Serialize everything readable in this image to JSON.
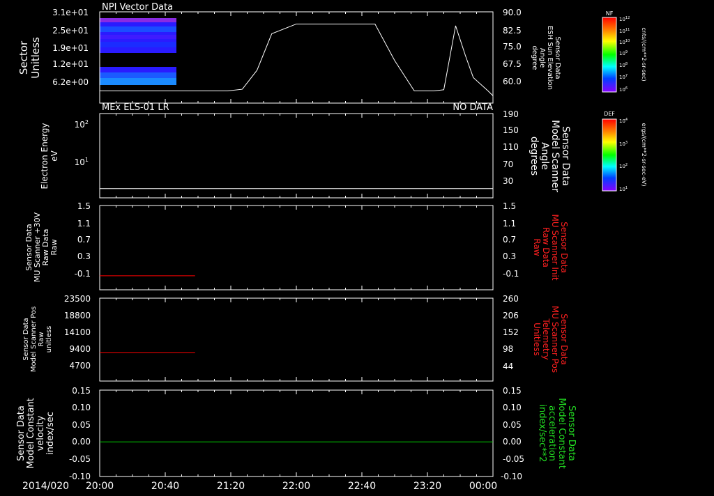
{
  "chart_data": [
    {
      "type": "heatmap+line",
      "title": "NPI Vector Data",
      "left_ylabel": [
        "Sector",
        "Unitless"
      ],
      "left_ticks": [
        "3.1e+01",
        "2.5e+01",
        "1.9e+01",
        "1.2e+01",
        "6.2e+00"
      ],
      "right_ylabel": [
        "Sensor Data",
        "ESH Sun Elevation",
        "Angle",
        "degree"
      ],
      "right_ticks": [
        "90.0",
        "82.5",
        "75.0",
        "67.5",
        "60.0"
      ],
      "right_ylim": [
        52.5,
        90.0
      ],
      "colorbar": {
        "label": "NF",
        "unit": "cnts/(cm**2-sr-sec)",
        "ticks": [
          "10^12",
          "10^11",
          "10^10",
          "10^9",
          "10^8",
          "10^7",
          "10^6"
        ]
      },
      "heatmap_x_range_hours": [
        0,
        0.833
      ],
      "line_series": {
        "color": "#ffffff",
        "x_hours": [
          0,
          0.5,
          1.0,
          1.3,
          1.45,
          1.6,
          1.75,
          2.0,
          2.5,
          2.8,
          3.0,
          3.2,
          3.3,
          3.4,
          3.5,
          3.62,
          3.72,
          3.8,
          3.95,
          4.0
        ],
        "y": [
          57.5,
          57.5,
          57.5,
          57.5,
          58.2,
          66,
          81,
          85,
          85,
          85,
          70,
          57.5,
          57.5,
          57.5,
          58,
          84.3,
          72,
          63,
          57.5,
          55.5
        ]
      }
    },
    {
      "type": "heatmap+line",
      "title": "MEx ELS-01 LR",
      "status": "NO DATA",
      "left_ylabel": [
        "Electron Energy",
        "eV"
      ],
      "left_ticks": [
        "10^2",
        "10^1"
      ],
      "right_ylabel": [
        "Sensor Data",
        "Model Scanner",
        "Angle",
        "degrees"
      ],
      "right_ticks": [
        "190",
        "150",
        "110",
        "70",
        "30"
      ],
      "right_ylim": [
        -10,
        190
      ],
      "colorbar": {
        "label": "DEF",
        "unit": "ergs/(cm**2-sr-sec-eV)",
        "ticks": [
          "10^4",
          "10^3",
          "10^2",
          "10^1"
        ]
      },
      "line_series": {
        "color": "#ffffff",
        "x_hours": [
          0,
          4.0
        ],
        "y": [
          12,
          12
        ]
      }
    },
    {
      "type": "line",
      "left_ylabel": [
        "Sensor Data",
        "MU Scanner +30V",
        "Raw Data",
        "Raw"
      ],
      "left_ticks": [
        "1.5",
        "1.1",
        "0.7",
        "0.3",
        "-0.1"
      ],
      "right_ylabel": [
        "Sensor Data",
        "MU Scanner Init",
        "Raw Data",
        "Raw"
      ],
      "right_ticks": [
        "1.5",
        "1.1",
        "0.7",
        "0.3",
        "-0.1"
      ],
      "ylim": [
        -0.3,
        1.5
      ],
      "series": [
        {
          "color": "#ff0000",
          "x_hours": [
            0,
            0.97
          ],
          "y": [
            0,
            0
          ]
        }
      ]
    },
    {
      "type": "line",
      "left_ylabel": [
        "Sensor Data",
        "Model Scanner Pos",
        "Raw",
        "unitless"
      ],
      "left_ticks": [
        "23500",
        "18800",
        "14100",
        "9400",
        "4700"
      ],
      "right_ylabel": [
        "Sensor Data",
        "MU Scanner Pos",
        "Telemetry",
        "Unitless"
      ],
      "right_ticks": [
        "260",
        "206",
        "152",
        "98",
        "44"
      ],
      "ylim": [
        0,
        23500
      ],
      "series": [
        {
          "color": "#ff0000",
          "x_hours": [
            0,
            0.97
          ],
          "y": [
            8000,
            8000
          ]
        }
      ]
    },
    {
      "type": "line",
      "left_ylabel": [
        "Sensor Data",
        "Model Constant",
        "velocity",
        "index/sec"
      ],
      "left_ticks": [
        "0.15",
        "0.10",
        "0.05",
        "0.00",
        "-0.05",
        "-0.10"
      ],
      "right_ylabel": [
        "Sensor Data",
        "Model Constant",
        "acceleration",
        "index/sec**2"
      ],
      "right_ticks": [
        "0.15",
        "0.10",
        "0.05",
        "0.00",
        "-0.05",
        "-0.10"
      ],
      "ylim": [
        -0.1,
        0.15
      ],
      "series": [
        {
          "color": "#00dd00",
          "x_hours": [
            0,
            4.0
          ],
          "y": [
            0,
            0
          ]
        }
      ]
    }
  ],
  "x_axis": {
    "date_label": "2014/020",
    "ticks": [
      "20:00",
      "20:40",
      "21:20",
      "22:00",
      "22:40",
      "23:20",
      "00:00"
    ],
    "range_hours": [
      0,
      4.0
    ]
  }
}
